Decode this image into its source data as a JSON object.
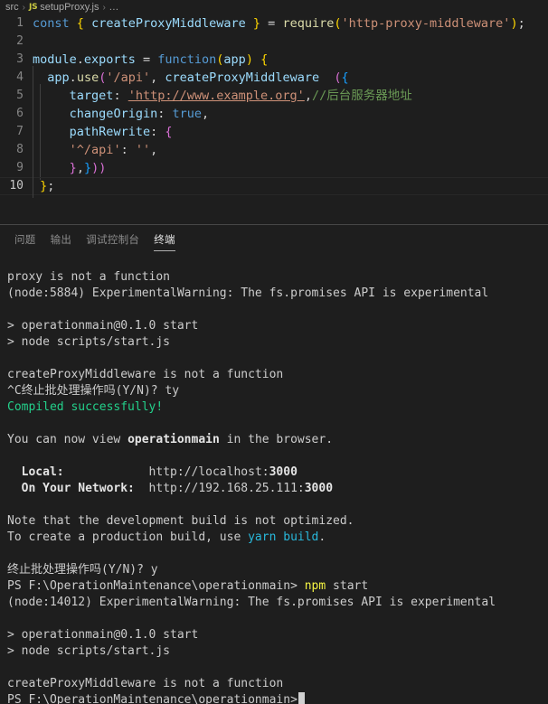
{
  "breadcrumb": {
    "folder": "src",
    "separator": "›",
    "file_icon_label": "JS",
    "file": "setupProxy.js",
    "dots": "..."
  },
  "editor": {
    "language": "javascript",
    "active_line": 10,
    "lines": [
      {
        "num": "1",
        "text": "const { createProxyMiddleware } = require('http-proxy-middleware');"
      },
      {
        "num": "2",
        "text": ""
      },
      {
        "num": "3",
        "text": "module.exports = function(app) {"
      },
      {
        "num": "4",
        "text": "  app.use('/api', createProxyMiddleware  ({"
      },
      {
        "num": "5",
        "text": "    target: 'http://www.example.org',//后台服务器地址"
      },
      {
        "num": "6",
        "text": "    changeOrigin: true,"
      },
      {
        "num": "7",
        "text": "    pathRewrite: {"
      },
      {
        "num": "8",
        "text": "    '^/api': '',"
      },
      {
        "num": "9",
        "text": "    },}))"
      },
      {
        "num": "10",
        "text": "};"
      }
    ]
  },
  "panel": {
    "tabs": [
      {
        "id": "problems",
        "label": "问题",
        "active": false
      },
      {
        "id": "output",
        "label": "输出",
        "active": false
      },
      {
        "id": "debug",
        "label": "调试控制台",
        "active": false
      },
      {
        "id": "terminal",
        "label": "终端",
        "active": true
      }
    ]
  },
  "terminal": {
    "lines": [
      "proxy is not a function",
      "(node:5884) ExperimentalWarning: The fs.promises API is experimental",
      "",
      "> operationmain@0.1.0 start",
      "> node scripts/start.js",
      "",
      "createProxyMiddleware is not a function",
      "^C终止批处理操作吗(Y/N)? ty",
      "Compiled successfully!",
      "",
      "You can now view operationmain in the browser.",
      "",
      "  Local:            http://localhost:3000",
      "  On Your Network:  http://192.168.25.111:3000",
      "",
      "Note that the development build is not optimized.",
      "To create a production build, use yarn build.",
      "",
      "终止批处理操作吗(Y/N)? y",
      "PS F:\\OperationMaintenance\\operationmain> npm start",
      "(node:14012) ExperimentalWarning: The fs.promises API is experimental",
      "",
      "> operationmain@0.1.0 start",
      "> node scripts/start.js",
      "",
      "createProxyMiddleware is not a function",
      "PS F:\\OperationMaintenance\\operationmain> "
    ],
    "prompt_path": "PS F:\\OperationMaintenance\\operationmain>",
    "command": "npm start",
    "success_message": "Compiled successfully!",
    "local_url": "http://localhost:3000",
    "network_url": "http://192.168.25.111:3000",
    "app_name": "operationmain",
    "port": "3000"
  },
  "colors": {
    "editor_bg": "#1e1e1e",
    "terminal_bg": "#1e1e1e",
    "green": "#23d18b",
    "cyan": "#29b8db",
    "yellow": "#f5f543",
    "keyword_blue": "#569cd6",
    "string_orange": "#ce9178",
    "comment_green": "#6a9955"
  }
}
